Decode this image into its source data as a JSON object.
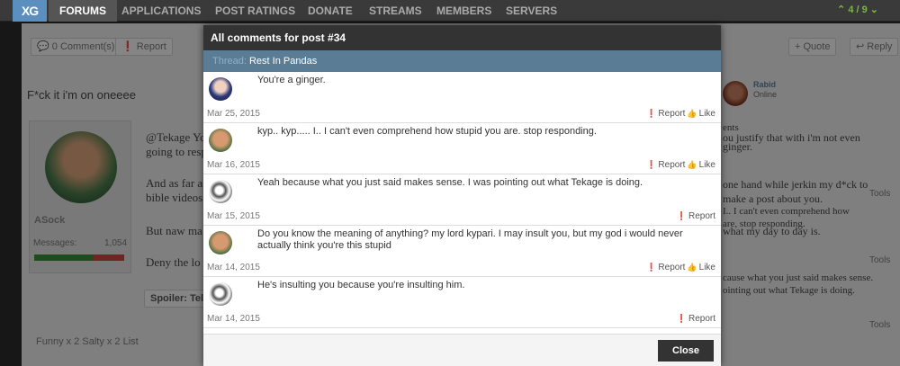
{
  "nav": {
    "logo": "XG",
    "items": [
      "FORUMS",
      "APPLICATIONS",
      "POST RATINGS",
      "DONATE",
      "STREAMS",
      "MEMBERS",
      "SERVERS"
    ],
    "pager": "4 / 9"
  },
  "background": {
    "comments_btn": "0 Comment(s)",
    "report_btn": "Report",
    "quote_btn": "+ Quote",
    "reply_btn": "Reply",
    "post_title": "F*ck it i'm on oneeee",
    "post_line1": "@Tekage Yo",
    "post_line1b": "going to resp",
    "post_line2": "And as far a",
    "post_line2b": "bible videos",
    "post_line3": "But naw ma",
    "post_line4": "Deny the lo",
    "spoiler": "Spoiler: Tel",
    "username": "ASock",
    "messages_label": "Messages:",
    "messages_count": "1,054",
    "reactions": "Funny x 2   Salty x 2   List",
    "right_user": "Rabid",
    "right_status": "Online",
    "right_texts": [
      "ents",
      "ou justify that with i'm not even",
      "ginger.",
      "one hand while jerkin my d*ck to",
      "make a post about you.",
      "I.. I can't even comprehend how",
      "are, stop responding.",
      "what my day to day is.",
      "cause what you just said makes sense.",
      "ointing out what Tekage is doing."
    ],
    "tools": "Tools"
  },
  "modal": {
    "title": "All comments for post #34",
    "thread_prefix": "Thread:",
    "thread_name": "Rest In Pandas",
    "close_label": "Close",
    "comments": [
      {
        "text": "You're a ginger.",
        "date": "Mar 25, 2015",
        "report": "Report",
        "like": "Like",
        "avatar": "anime-avatar"
      },
      {
        "text": "kyp.. kyp..... I.. I can't even comprehend how stupid you are. stop responding.",
        "date": "Mar 16, 2015",
        "report": "Report",
        "like": "Like",
        "avatar": "boy-avatar"
      },
      {
        "text": "Yeah because what you just said makes sense. I was pointing out what Tekage is doing.",
        "date": "Mar 15, 2015",
        "report": "Report",
        "like": "",
        "avatar": "sketch-avatar"
      },
      {
        "text": "Do you know the meaning of anything? my lord kypari. I may insult you, but my god i would never actually think you're this stupid",
        "date": "Mar 14, 2015",
        "report": "Report",
        "like": "Like",
        "avatar": "boy-avatar"
      },
      {
        "text": "He's insulting you because you're insulting him.",
        "date": "Mar 14, 2015",
        "report": "Report",
        "like": "",
        "avatar": "sketch-avatar"
      }
    ]
  }
}
